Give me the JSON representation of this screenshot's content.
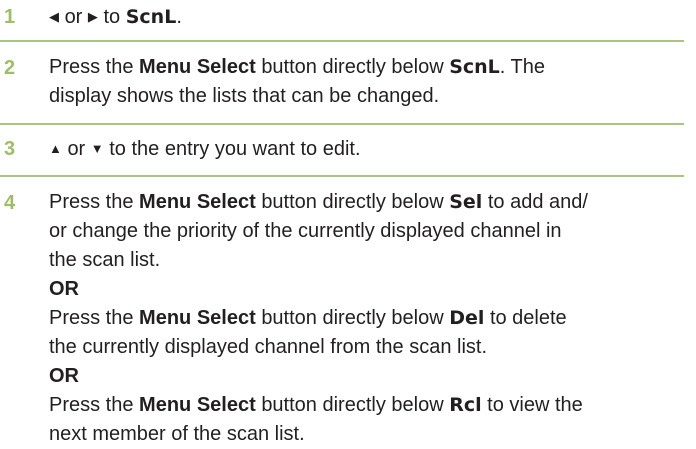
{
  "steps": [
    {
      "num": "1",
      "left_arrow": "◀",
      "or": "or",
      "right_arrow": "▶",
      "to": "to",
      "display": "ScnL",
      "end": "."
    },
    {
      "num": "2",
      "line1_pre": "Press the",
      "button": "Menu Select",
      "line1_mid": "button directly below",
      "display": "ScnL",
      "line1_post": ". The",
      "line2": "display shows the lists that can be changed."
    },
    {
      "num": "3",
      "up_arrow": "▲",
      "or": "or",
      "down_arrow": "▼",
      "text": "to the entry you want to edit."
    },
    {
      "num": "4",
      "a_pre": "Press the",
      "button": "Menu Select",
      "a_mid": "button directly below",
      "a_display": "Sel",
      "a_post": "to add and/",
      "a_line2": "or change the priority of the currently displayed channel in",
      "a_line3": "the scan list.",
      "or1": "OR",
      "b_pre": "Press the",
      "b_mid": "button directly below",
      "b_display": "Del",
      "b_post": "to delete",
      "b_line2": "the currently displayed channel from the scan list.",
      "or2": "OR",
      "c_pre": "Press the",
      "c_mid": "button directly below",
      "c_display": "Rcl",
      "c_post": "to view the",
      "c_line2": "next member of the scan list."
    }
  ],
  "colors": {
    "number": "#9fbd68",
    "rule": "#a9c47e",
    "text": "#231f20"
  }
}
